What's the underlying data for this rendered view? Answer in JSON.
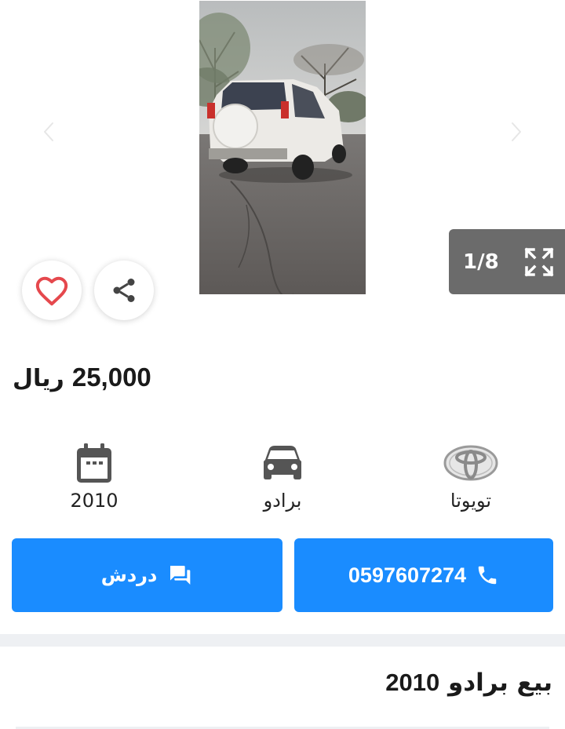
{
  "gallery": {
    "counter": "1/8",
    "prev_icon": "chevron-left-icon",
    "next_icon": "chevron-right-icon",
    "expand_icon": "fullscreen-icon"
  },
  "actions": {
    "favorite_icon": "heart-icon",
    "share_icon": "share-icon"
  },
  "price": {
    "amount": "25,000",
    "currency": "ريال"
  },
  "specs": [
    {
      "icon": "calendar-icon",
      "label": "2010"
    },
    {
      "icon": "car-icon",
      "label": "برادو"
    },
    {
      "icon": "toyota-logo-icon",
      "label": "تويوتا"
    }
  ],
  "buttons": {
    "chat_label": "دردش",
    "call_label": "0597607274"
  },
  "colors": {
    "primary": "#1a8cff",
    "counter_bg": "#6b6b6b",
    "heart": "#e5484d",
    "divider": "#eef0f3"
  },
  "ad": {
    "title_text": "بيع برادو",
    "title_year": "2010"
  }
}
